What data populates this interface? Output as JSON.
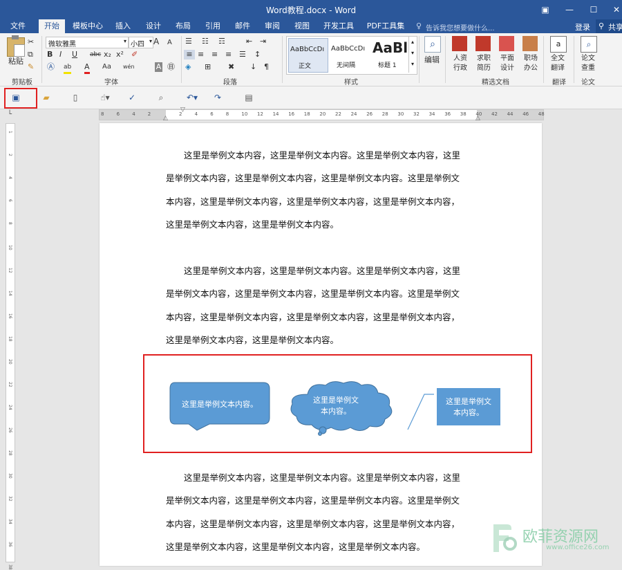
{
  "window": {
    "title": "Word教程.docx - Word",
    "login": "登录",
    "share": "共享"
  },
  "menu": {
    "tabs": [
      "文件",
      "开始",
      "模板中心",
      "插入",
      "设计",
      "布局",
      "引用",
      "邮件",
      "审阅",
      "视图",
      "开发工具",
      "PDF工具集"
    ],
    "active": "开始",
    "tell_me": "告诉我您想要做什么..."
  },
  "ribbon": {
    "clipboard": {
      "paste": "粘贴",
      "label": "剪贴板"
    },
    "font": {
      "name": "微软雅黑",
      "size": "小四",
      "label": "字体",
      "bold": "B",
      "italic": "I",
      "underline": "U",
      "strike": "abc",
      "sub": "x₂",
      "sup": "x²",
      "aa": "Aa",
      "wen": "wén",
      "A": "A"
    },
    "paragraph": {
      "label": "段落"
    },
    "styles": {
      "items": [
        {
          "preview": "AaBbCcDı",
          "name": "正文"
        },
        {
          "preview": "AaBbCcDı",
          "name": "无间隔"
        },
        {
          "preview": "AaBl",
          "name": "标题 1"
        }
      ],
      "label": "样式"
    },
    "editing": {
      "label": "编辑"
    },
    "templates": {
      "items": [
        "人资行政",
        "求职简历",
        "平面设计",
        "职场办公"
      ],
      "label": "精选文档"
    },
    "translate": {
      "item": "全文翻译",
      "label": "翻译"
    },
    "paper": {
      "item": "论文查重",
      "label": "论文"
    }
  },
  "ruler": {
    "h": [
      "8",
      "6",
      "4",
      "2",
      "",
      "2",
      "4",
      "6",
      "8",
      "10",
      "12",
      "14",
      "16",
      "18",
      "20",
      "22",
      "24",
      "26",
      "28",
      "30",
      "32",
      "34",
      "36",
      "38",
      "40",
      "42",
      "44",
      "46",
      "48"
    ],
    "v": [
      "1",
      "2",
      "4",
      "6",
      "8",
      "10",
      "12",
      "14",
      "16",
      "18",
      "20",
      "22",
      "24",
      "26",
      "28",
      "30",
      "32",
      "34",
      "36",
      "38"
    ]
  },
  "document": {
    "paragraphs": [
      [
        "这里是举例文本内容，这里是举例文本内容。这里是举例文本内容，这里",
        "是举例文本内容，这里是举例文本内容，这里是举例文本内容。这里是举例文",
        "本内容，这里是举例文本内容，这里是举例文本内容，这里是举例文本内容，",
        "这里是举例文本内容，这里是举例文本内容。"
      ],
      [
        "这里是举例文本内容，这里是举例文本内容。这里是举例文本内容，这里",
        "是举例文本内容，这里是举例文本内容，这里是举例文本内容。这里是举例文",
        "本内容，这里是举例文本内容，这里是举例文本内容，这里是举例文本内容，",
        "这里是举例文本内容，这里是举例文本内容。"
      ],
      [
        "这里是举例文本内容，这里是举例文本内容。这里是举例文本内容，这里",
        "是举例文本内容，这里是举例文本内容，这里是举例文本内容。这里是举例文",
        "本内容，这里是举例文本内容，这里是举例文本内容，这里是举例文本内容，",
        "这里是举例文本内容，这里是举例文本内容，这里是举例文本内容。"
      ]
    ],
    "shapes": {
      "rect_callout": "这里是举例文本内容。",
      "cloud_callout": [
        "这里是举例文",
        "本内容。"
      ],
      "line_callout": [
        "这里是举例文",
        "本内容。"
      ]
    }
  },
  "watermark": {
    "brand": "欧菲资源网",
    "url": "www.office26.com"
  },
  "colors": {
    "accent": "#2b579a",
    "highlight": "#e02020",
    "shape_fill": "#5b9bd5"
  }
}
